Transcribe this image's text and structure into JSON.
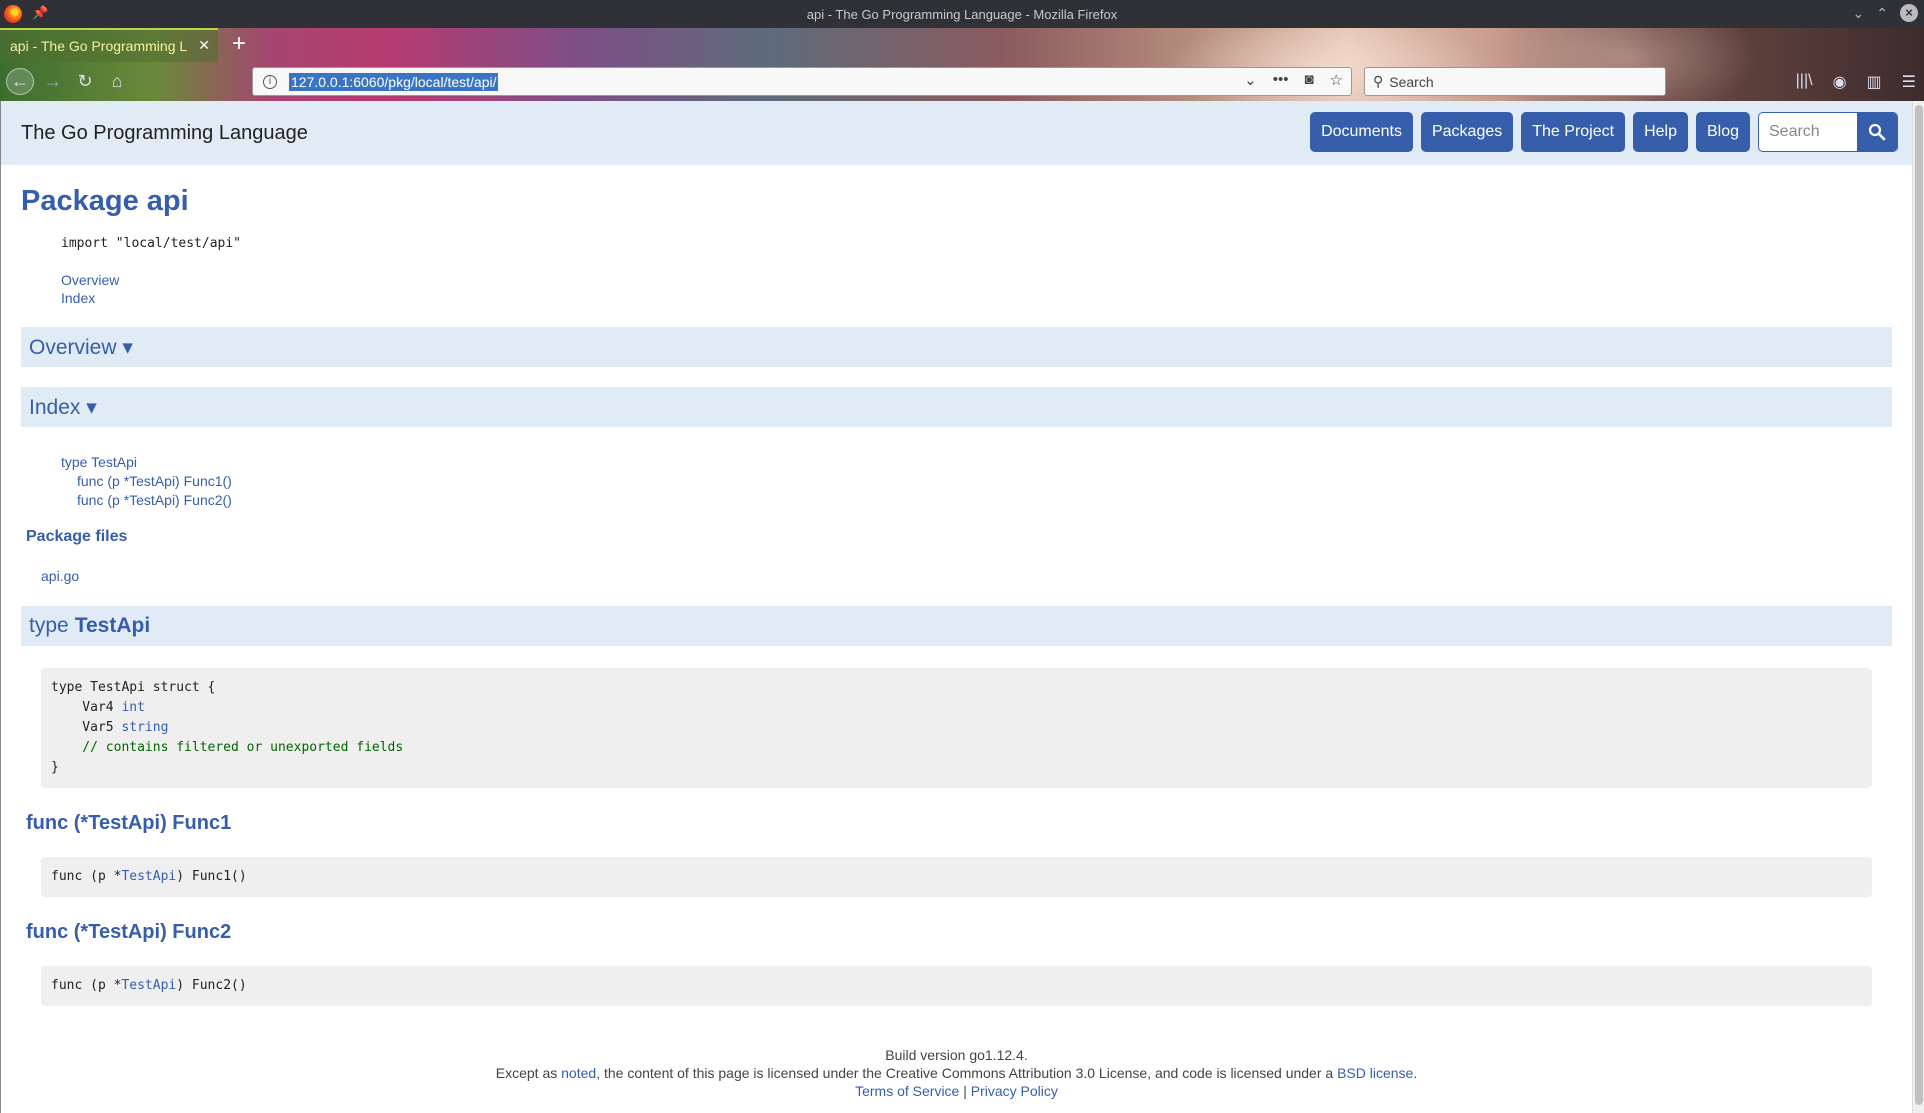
{
  "window": {
    "title": "api - The Go Programming Language - Mozilla Firefox"
  },
  "tab": {
    "label": "api - The Go Programming L",
    "close": "✕",
    "new_tab": "+"
  },
  "urlbar": {
    "url": "127.0.0.1:6060/pkg/local/test/api/"
  },
  "browser_search": {
    "placeholder": "Search"
  },
  "site": {
    "title": "The Go Programming Language",
    "menu": [
      "Documents",
      "Packages",
      "The Project",
      "Help",
      "Blog"
    ],
    "search_placeholder": "Search"
  },
  "package": {
    "heading": "Package api",
    "import_line": "import \"local/test/api\"",
    "toc": [
      "Overview",
      "Index"
    ],
    "overview_heading": "Overview ▾",
    "index_heading": "Index ▾",
    "index_items": {
      "type": "type TestApi",
      "func1": "func (p *TestApi) Func1()",
      "func2": "func (p *TestApi) Func2()"
    },
    "package_files_heading": "Package files",
    "files": [
      "api.go"
    ]
  },
  "type_section": {
    "prefix": "type",
    "name": "TestApi",
    "code": {
      "l1": "type TestApi struct {",
      "var4": "    Var4 ",
      "var4_type": "int",
      "var5": "    Var5 ",
      "var5_type": "string",
      "comment": "    // contains filtered or unexported fields",
      "close": "}"
    }
  },
  "func1": {
    "heading": "func (*TestApi) Func1",
    "pre": "func (p *",
    "type_link": "TestApi",
    "post": ") Func1()"
  },
  "func2": {
    "heading": "func (*TestApi) Func2",
    "pre": "func (p *",
    "type_link": "TestApi",
    "post": ") Func2()"
  },
  "footer": {
    "build": "Build version go1.12.4.",
    "license_pre": "Except as ",
    "noted": "noted",
    "license_mid": ", the content of this page is licensed under the Creative Commons Attribution 3.0 License, and code is licensed under a ",
    "bsd": "BSD license",
    "license_end": ".",
    "terms": "Terms of Service",
    "sep": " | ",
    "privacy": "Privacy Policy"
  }
}
